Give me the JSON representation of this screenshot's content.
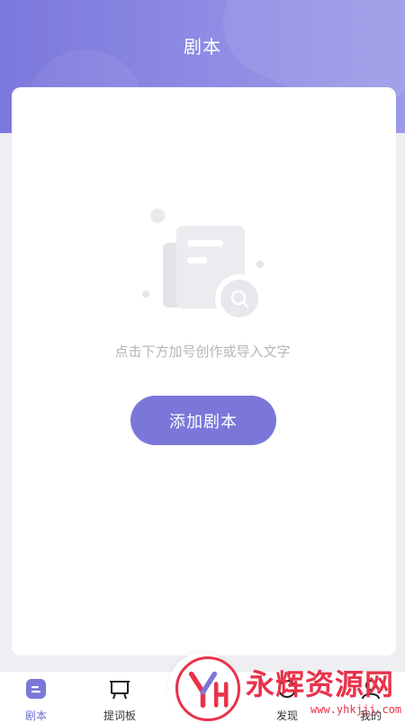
{
  "header": {
    "title": "剧本"
  },
  "empty_state": {
    "hint": "点击下方加号创作或导入文字",
    "add_button_label": "添加剧本"
  },
  "tabbar": {
    "items": [
      {
        "label": "剧本",
        "icon": "script-icon",
        "active": true
      },
      {
        "label": "提词板",
        "icon": "teleprompter-icon",
        "active": false
      },
      {
        "label": "发现",
        "icon": "discover-icon",
        "active": false
      },
      {
        "label": "我的",
        "icon": "profile-icon",
        "active": false
      }
    ],
    "center_button_icon": "plus-icon"
  },
  "watermark": {
    "brand": "永辉资源网",
    "url": "www.yhkjjj.com"
  },
  "colors": {
    "accent": "#7b77d9",
    "active_tab": "#6f6bd6",
    "watermark_red": "#e8334a"
  }
}
